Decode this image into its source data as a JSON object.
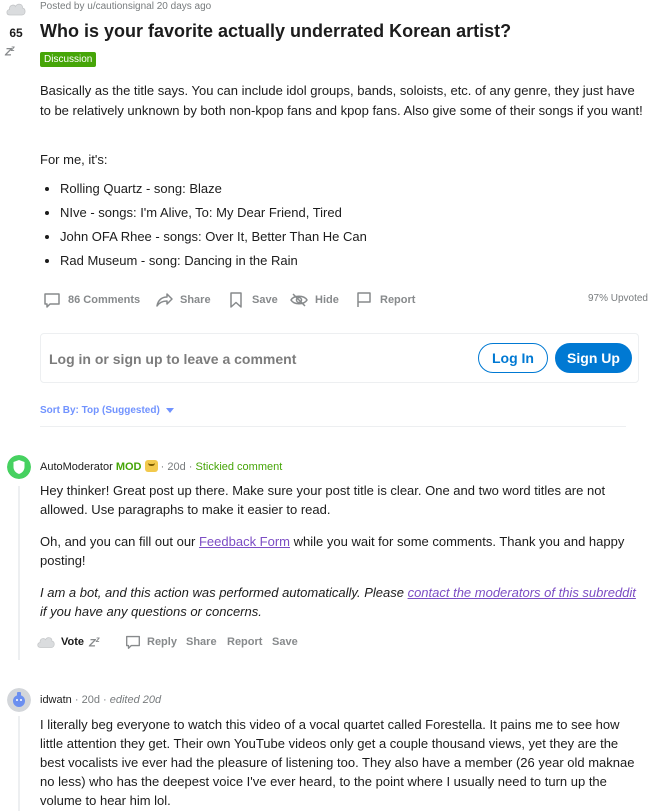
{
  "post": {
    "score": "65",
    "posted_by": "Posted by u/cautionsignal 20 days ago",
    "title": "Who is your favorite actually underrated Korean artist?",
    "flair": "Discussion",
    "body_p1": "Basically as the title says. You can include idol groups, bands, soloists, etc. of any genre, they just have to be relatively unknown by both non-kpop fans and kpop fans. Also give some of their songs if you want!",
    "body_p2": "For me, it's:",
    "list": [
      "Rolling Quartz - song: Blaze",
      "NIve - songs: I'm Alive, To: My Dear Friend, Tired",
      "John OFA Rhee - songs: Over It, Better Than He Can",
      "Rad Museum - song: Dancing in the Rain"
    ],
    "actions": {
      "comments": "86 Comments",
      "share": "Share",
      "save": "Save",
      "hide": "Hide",
      "report": "Report"
    },
    "upvoted": "97% Upvoted"
  },
  "login_box": {
    "prompt": "Log in or sign up to leave a comment",
    "login_label": "Log In",
    "signup_label": "Sign Up"
  },
  "sort": {
    "label": "Sort By: Top (Suggested)"
  },
  "comments": [
    {
      "author": "AutoModerator",
      "mod_badge": "MOD",
      "time": "· 20d ·",
      "stickied": "Stickied comment",
      "p1": "Hey thinker! Great post up there. Make sure your post title is clear. One and two word titles are not allowed. Use paragraphs to make it easier to read.",
      "p2_before": "Oh, and you can fill out our ",
      "p2_link": "Feedback Form",
      "p2_after": " while you wait for some comments. Thank you and happy posting!",
      "p3_before": "I am a bot, and this action was performed automatically. Please ",
      "p3_link": "contact the moderators of this subreddit",
      "p3_after": " if you have any questions or concerns.",
      "actions": {
        "vote": "Vote",
        "reply": "Reply",
        "share": "Share",
        "report": "Report",
        "save": "Save"
      }
    },
    {
      "author": "idwatn",
      "time": "· 20d ·",
      "edited": "edited 20d",
      "p1": "I literally beg everyone to watch this video of a vocal quartet called Forestella. It pains me to see how little attention they get. Their own YouTube videos only get a couple thousand views, yet they are the best vocalists ive ever had the pleasure of listening too. They also have a member (26 year old maknae no less) who has the deepest voice I've ever heard, to the point where I usually need to turn up the volume to hear him lol."
    }
  ],
  "colors": {
    "accent_blue": "#0079d3",
    "mod_green": "#46a508",
    "sort_blue": "#7193ff",
    "link_purple": "#7c4dc4"
  }
}
